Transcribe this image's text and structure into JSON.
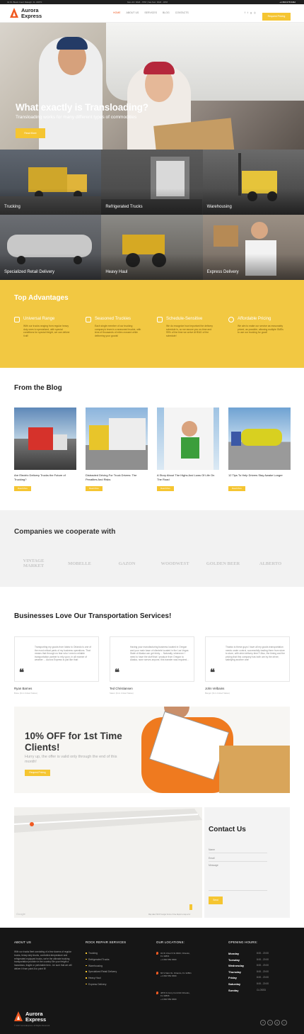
{
  "topbar": {
    "address": "02 W. Black Court Raleigh, FL 34870",
    "hours": "Mon-Fri: 8AM - 7PM | Sat-Sun: 8AM - 3PM",
    "phone": "+1 800 078 6462"
  },
  "header": {
    "logo_line1": "Aurora",
    "logo_line2": "Express",
    "nav": [
      "Home",
      "About Us",
      "Services",
      "Blog",
      "Contacts"
    ],
    "quote_button": "Request Pricing"
  },
  "hero": {
    "title": "What exactly is Transloading?",
    "subtitle": "Transloading works for many different types of commodities",
    "button": "Read More",
    "slides": 3,
    "active_slide": 1
  },
  "services": [
    {
      "label": "Trucking"
    },
    {
      "label": "Refrigerated Trucks"
    },
    {
      "label": "Warehousing"
    },
    {
      "label": "Specialized Retail Delivery"
    },
    {
      "label": "Heavy Haul"
    },
    {
      "label": "Express Delivery"
    }
  ],
  "advantages": {
    "title": "Top Advantages",
    "items": [
      {
        "title": "Universal Range",
        "text": "With our trucks ranging from regular heavy duty ones to specialized, with special conditions for special freight, we can deliver it all!"
      },
      {
        "title": "Seasoned Truckies",
        "text": "Each single member of our trucking company's team is a seasoned truckie, with tens of thousands of miles crossed while delivering your goods!"
      },
      {
        "title": "Schedule-Sensitive",
        "text": "We do recognize how important the delivery schedule is, so we assure you on-time and 99% of the time we arrive AHEAD of the schedule!"
      },
      {
        "title": "Affordable Pricing",
        "text": "We aim to make our service as reasonably priced, as possible, allowing multiple SMEs to use our trucking for good!"
      }
    ]
  },
  "blog": {
    "title": "From the Blog",
    "read_more": "Read More",
    "posts": [
      {
        "title": "Are Electric Delivery Trucks the Future of Trucking?"
      },
      {
        "title": "Distracted Driving For Truck Drivers: The Penalties And Risks"
      },
      {
        "title": "A Story About The Highs And Lows Of Life On The Road"
      },
      {
        "title": "12 Tips To Help Drivers Stay Awake Longer"
      }
    ]
  },
  "partners": {
    "title": "Companies we cooperate with",
    "logos": [
      "VINTAGE MARKET",
      "MOBELLE",
      "GAZON",
      "WOODWEST",
      "GOLDEN BEER",
      "ALBERTO"
    ]
  },
  "testimonials": {
    "title": "Businesses Love Our Transportation Services!",
    "items": [
      {
        "text": "Transporting my goods from Idaho to Orlando is one of the most critical parts of my business operations. That means that through no fear who I need a reliable transportation partner to rely upon, in all manner of weather ... Aurora Express is just like that!",
        "name": "Ryan Barnes",
        "role": "Boise (from United States)"
      },
      {
        "text": "Having your manufacturing business located in Oregon and your main base of clientele located in the Las Vegas State of Alaska can get tricky ... Naturally, whenever I need to have the stuff that I produce from Oregon to Alaska, none serves anyone, this transfer was required...",
        "name": "Ted Christiansen",
        "role": "Salem (from United States)"
      },
      {
        "text": "Thanks to these guys I have all my goods transportation needs under control, successfully trading them from store to store, with strict delivery time?! Also, the timing and the pricing that this company has both are by the driver, satisfying another one!",
        "name": "John Velbains",
        "role": "Bangor (from United States)"
      }
    ]
  },
  "promo": {
    "title": "10% OFF for 1st Time Clients!",
    "text": "Hurry up, the offer is valid only through the end of this month!",
    "button": "Request Pricing"
  },
  "map": {
    "google": "Google",
    "footer": "Map data ©2017 Google  Terms of Use  Report a map error"
  },
  "contact": {
    "title": "Contact Us",
    "name_placeholder": "Name",
    "email_placeholder": "Email",
    "message_placeholder": "Message",
    "send": "Send"
  },
  "footer": {
    "about_title": "About Us",
    "about_text": "With our trucks fleet consisting of a few dozens of regular trucks, heavy duty trucks, controlled-temperature and refrigerated equipped trucks, we're the ultimate trucking transportation provider in the country! Be your freight a hazardous, fragile or perishable item - be sure that we will deliver it from point A to point B!",
    "services_title": "Rock Repair Services",
    "services": [
      "Trucking",
      "Refrigerated Trucks",
      "Warehousing",
      "Specialized Retail Delivery",
      "Heavy Haul",
      "Express Delivery"
    ],
    "locations_title": "Our Locations:",
    "locations": [
      {
        "address": "02 W Church St #900, Orlando, FL 32801",
        "phone": "+1 800 559 6580"
      },
      {
        "address": "66 S Main St, Orlando, FL 32801",
        "phone": "+1 800 559 6580"
      },
      {
        "address": "4876 S Curry Ford Rd Orlando, FL 32806",
        "phone": "+1 800 559 6580"
      }
    ],
    "hours_title": "Opening Hours:",
    "hours": [
      {
        "day": "Monday",
        "value": "8:00 - 20:00"
      },
      {
        "day": "Tuesday",
        "value": "8:00 - 20:00"
      },
      {
        "day": "Wednesday",
        "value": "8:00 - 20:00"
      },
      {
        "day": "Thursday",
        "value": "8:00 - 20:00"
      },
      {
        "day": "Friday",
        "value": "8:00 - 20:00"
      },
      {
        "day": "Saturday",
        "value": "8:00 - 20:00"
      },
      {
        "day": "Sunday",
        "value": "CLOSED"
      }
    ],
    "copyright": "© 2017 AuroraExpress. All Rights Reserved.",
    "social": [
      "f",
      "t",
      "g",
      "i"
    ]
  },
  "colors": {
    "accent": "#f5c531",
    "brand": "#f05a22",
    "dark": "#161616"
  }
}
